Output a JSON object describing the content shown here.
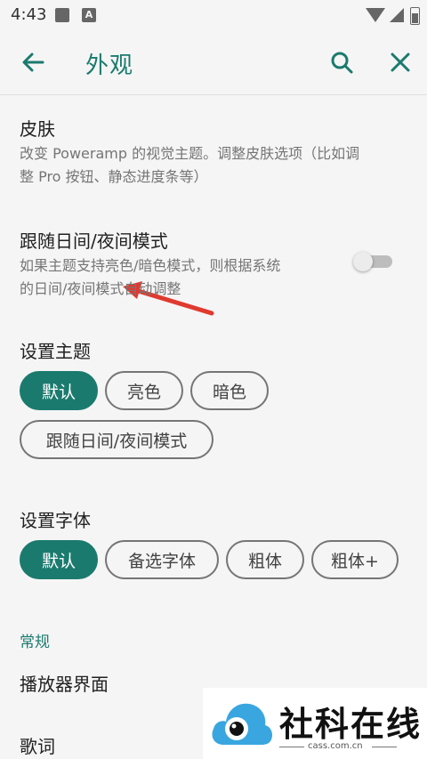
{
  "status_bar": {
    "time": "4:43",
    "icons": [
      "image-icon",
      "a-badge-icon",
      "wifi-icon",
      "signal-icon",
      "battery-icon"
    ]
  },
  "toolbar": {
    "title": "外观",
    "back_icon": "arrow-left-icon",
    "search_icon": "search-icon",
    "close_icon": "close-icon"
  },
  "prefs": {
    "skin": {
      "title": "皮肤",
      "summary_line1": "改变 Poweramp 的视觉主题。调整皮肤选项（比如调",
      "summary_line2": "整 Pro 按钮、静态进度条等）"
    },
    "follow_day_night": {
      "title": "跟随日间/夜间模式",
      "summary_line1": "如果主题支持亮色/暗色模式，则根据系统",
      "summary_line2": "的日间/夜间模式自动调整",
      "enabled": false
    }
  },
  "theme": {
    "heading": "设置主题",
    "chips": [
      "默认",
      "亮色",
      "暗色",
      "跟随日间/夜间模式"
    ],
    "selected": "默认"
  },
  "font": {
    "heading": "设置字体",
    "chips": [
      "默认",
      "备选字体",
      "粗体",
      "粗体+"
    ],
    "selected": "默认"
  },
  "general": {
    "category": "常规",
    "items": [
      "播放器界面",
      "歌词"
    ]
  },
  "watermark": {
    "name": "社科在线",
    "domain": "cass.com.cn"
  },
  "colors": {
    "accent": "#1b7a6e",
    "annotation_arrow": "#e03a2f",
    "background": "#f5f5f5"
  }
}
